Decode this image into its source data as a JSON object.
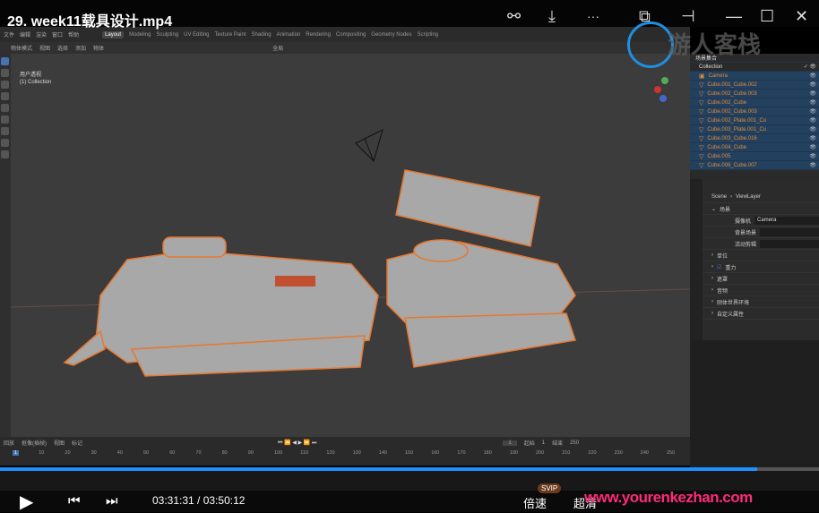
{
  "window": {
    "title": "29. week11载具设计.mp4",
    "share_icon": "share-icon",
    "download_icon": "download-icon",
    "more": "···"
  },
  "blender": {
    "menu": [
      "文件",
      "编辑",
      "渲染",
      "窗口",
      "帮助"
    ],
    "tabs": [
      "Layout",
      "Modeling",
      "Sculpting",
      "UV Editing",
      "Texture Paint",
      "Shading",
      "Animation",
      "Rendering",
      "Compositing",
      "Geometry Nodes",
      "Scripting"
    ],
    "header": [
      "物体模式",
      "视图",
      "选择",
      "添加",
      "物体"
    ],
    "transform": "全局",
    "viewport_info": [
      "用户透视",
      "(1) Collection"
    ],
    "outliner": {
      "title": "场景集合",
      "collection": "Collection",
      "items": [
        "Camera",
        "Cube.001_Cube.002",
        "Cube.002_Cube.003",
        "Cube.002_Cube",
        "Cube.002_Cube.003",
        "Cube.002_Plate.001_Cu",
        "Cube.003_Plate.001_Cu",
        "Cube.003_Cube.016",
        "Cube.004_Cube",
        "Cube.005",
        "Cube.006_Cube.007"
      ]
    },
    "properties": {
      "breadcrumb_scene": "Scene",
      "breadcrumb_layer": "ViewLayer",
      "section": "场景",
      "camera_label": "摄像机",
      "camera_value": "Camera",
      "bg_label": "背景场景",
      "clip_label": "活动剪辑",
      "panels": [
        "单位",
        "重力",
        "遮罩",
        "音频",
        "刚体世界环境",
        "自定义属性"
      ]
    },
    "timeline": {
      "menus": [
        "回放",
        "抠像(插帧)",
        "视图",
        "标记"
      ],
      "current": "1",
      "start_label": "起始",
      "start": "1",
      "end_label": "结束",
      "end": "250",
      "ticks": [
        "1",
        "10",
        "20",
        "30",
        "40",
        "50",
        "60",
        "70",
        "80",
        "90",
        "100",
        "110",
        "120",
        "130",
        "140",
        "150",
        "160",
        "170",
        "180",
        "190",
        "200",
        "210",
        "220",
        "230",
        "240",
        "250"
      ]
    }
  },
  "player": {
    "time": "03:31:31 / 03:50:12",
    "speed": "倍速",
    "quality": "超清",
    "svip": "SVIP",
    "watermark": "www.yourenkezhan.com",
    "logo_text": "游人客栈",
    "progress": 0.9243
  }
}
